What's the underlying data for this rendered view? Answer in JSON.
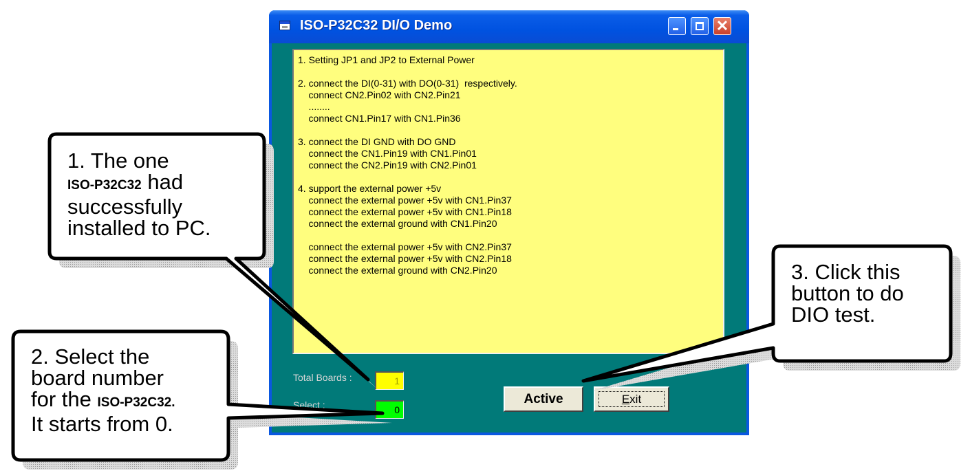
{
  "window": {
    "title": "ISO-P32C32 DI/O Demo",
    "minimize_label": "minimize",
    "maximize_label": "maximize",
    "close_glyph": "✕"
  },
  "notes": {
    "lines": [
      "1. Setting JP1 and JP2 to External Power",
      "",
      "2. connect the DI(0-31) with DO(0-31)  respectively.",
      "    connect CN2.Pin02 with CN2.Pin21",
      "    ........",
      "    connect CN1.Pin17 with CN1.Pin36",
      "",
      "3. connect the DI GND with DO GND",
      "    connect the CN1.Pin19 with CN1.Pin01",
      "    connect the CN2.Pin19 with CN2.Pin01",
      "",
      "4. support the external power +5v",
      "    connect the external power +5v with CN1.Pin37",
      "    connect the external power +5v with CN1.Pin18",
      "    connect the external ground with CN1.Pin20",
      "",
      "    connect the external power +5v with CN2.Pin37",
      "    connect the external power +5v with CN2.Pin18",
      "    connect the external ground with CN2.Pin20"
    ]
  },
  "form": {
    "total_boards_label": "Total Boards :",
    "total_boards_value": "1",
    "select_label": "Select :",
    "select_value": "0",
    "active_button": "Active",
    "exit_button_accel": "E",
    "exit_button_rest": "xit"
  },
  "callouts": {
    "c1": {
      "line1": "1. The one",
      "line2_bold": "ISO-P32C32",
      "line2_rest": " had",
      "line3": "successfully",
      "line4": "installed to PC."
    },
    "c2": {
      "line1": "2. Select the",
      "line2": "board number",
      "line3_pre": "for the ",
      "line3_bold": "ISO-P32C32.",
      "line4": "It starts from 0."
    },
    "c3": {
      "line1": "3. Click this",
      "line2": "button to do",
      "line3": "DIO test."
    }
  },
  "colors": {
    "titlebar": "#0052e0",
    "client": "#017a79",
    "notes_bg": "#fffe7e",
    "total_field": "#fffe00",
    "select_field": "#00ff00"
  }
}
